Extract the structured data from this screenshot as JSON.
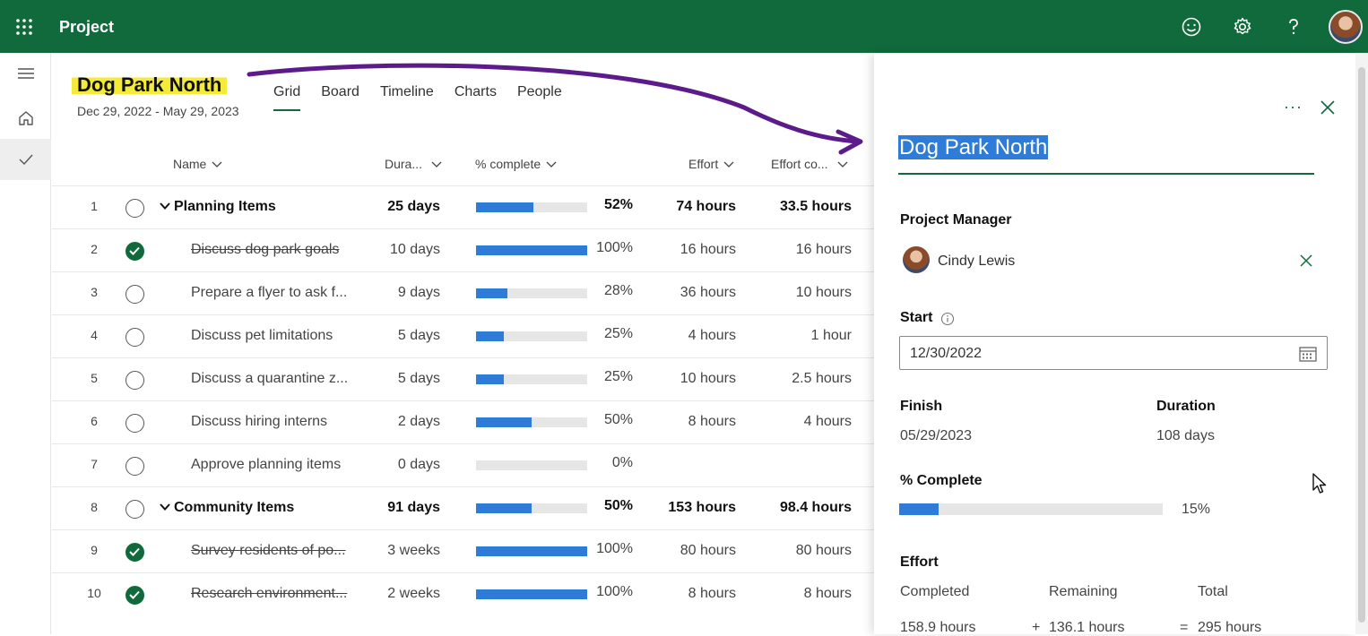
{
  "topbar": {
    "app_name": "Project",
    "icons": [
      "waffle-icon",
      "smiley-icon",
      "gear-icon",
      "help-icon",
      "avatar"
    ]
  },
  "project": {
    "title": "Dog Park North",
    "date_range": "Dec 29, 2022 - May 29, 2023"
  },
  "tabs": [
    {
      "label": "Grid",
      "active": true
    },
    {
      "label": "Board"
    },
    {
      "label": "Timeline"
    },
    {
      "label": "Charts"
    },
    {
      "label": "People"
    }
  ],
  "columns": {
    "name": "Name",
    "duration": "Dura...",
    "percent": "% complete",
    "effort": "Effort",
    "effort_completed": "Effort co..."
  },
  "rows": [
    {
      "num": "1",
      "summary": true,
      "done": false,
      "name": "Planning Items",
      "duration": "25 days",
      "pct": "52%",
      "pct_value": 52,
      "effort": "74 hours",
      "effort_c": "33.5 hours"
    },
    {
      "num": "2",
      "done": true,
      "name": "Discuss dog park goals",
      "duration": "10 days",
      "pct": "100%",
      "pct_value": 100,
      "effort": "16 hours",
      "effort_c": "16 hours"
    },
    {
      "num": "3",
      "done": false,
      "name": "Prepare a flyer to ask f...",
      "duration": "9 days",
      "pct": "28%",
      "pct_value": 28,
      "effort": "36 hours",
      "effort_c": "10 hours"
    },
    {
      "num": "4",
      "done": false,
      "name": "Discuss pet limitations",
      "duration": "5 days",
      "pct": "25%",
      "pct_value": 25,
      "effort": "4 hours",
      "effort_c": "1 hour"
    },
    {
      "num": "5",
      "done": false,
      "name": "Discuss a quarantine z...",
      "duration": "5 days",
      "pct": "25%",
      "pct_value": 25,
      "effort": "10 hours",
      "effort_c": "2.5 hours"
    },
    {
      "num": "6",
      "done": false,
      "name": "Discuss hiring interns",
      "duration": "2 days",
      "pct": "50%",
      "pct_value": 50,
      "effort": "8 hours",
      "effort_c": "4 hours"
    },
    {
      "num": "7",
      "done": false,
      "name": "Approve planning items",
      "duration": "0 days",
      "pct": "0%",
      "pct_value": 0,
      "effort": "",
      "effort_c": ""
    },
    {
      "num": "8",
      "summary": true,
      "done": false,
      "name": "Community Items",
      "duration": "91 days",
      "pct": "50%",
      "pct_value": 50,
      "effort": "153 hours",
      "effort_c": "98.4 hours"
    },
    {
      "num": "9",
      "done": true,
      "name": "Survey residents of po...",
      "duration": "3 weeks",
      "pct": "100%",
      "pct_value": 100,
      "effort": "80 hours",
      "effort_c": "80 hours"
    },
    {
      "num": "10",
      "done": true,
      "name": "Research environment...",
      "duration": "2 weeks",
      "pct": "100%",
      "pct_value": 100,
      "effort": "8 hours",
      "effort_c": "8 hours"
    }
  ],
  "panel": {
    "title": "Dog Park North",
    "project_manager_label": "Project Manager",
    "manager_name": "Cindy Lewis",
    "start_label": "Start",
    "start_value": "12/30/2022",
    "finish_label": "Finish",
    "finish_value": "05/29/2023",
    "duration_label": "Duration",
    "duration_value": "108 days",
    "complete_label": "% Complete",
    "complete_value": "15%",
    "complete_fraction": 0.15,
    "effort_label": "Effort",
    "completed_label": "Completed",
    "remaining_label": "Remaining",
    "total_label": "Total",
    "completed_value": "158.9 hours",
    "plus": "+",
    "remaining_value": "136.1 hours",
    "equals": "=",
    "total_value": "295 hours"
  },
  "colors": {
    "brand": "#106a3c",
    "progress": "#2e7bd8",
    "highlight": "#f4ea3a",
    "arrow": "#5c1a8a"
  }
}
